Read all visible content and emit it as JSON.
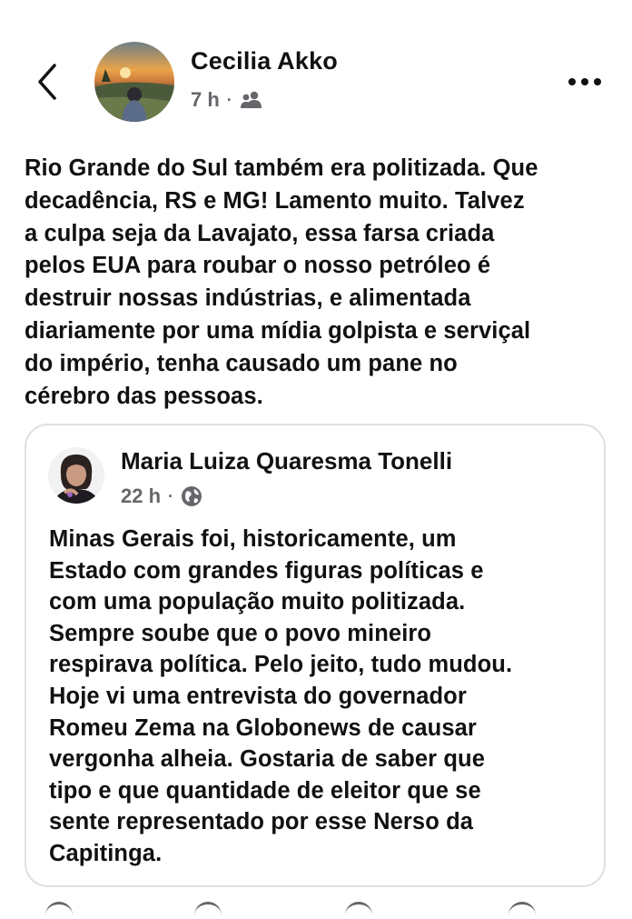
{
  "header": {
    "author": "Cecilia Akko",
    "time": "7 h",
    "separator": "·",
    "audience_icon": "friends-icon",
    "back_icon": "chevron-left-icon",
    "more_icon": "more-horizontal-icon"
  },
  "post": {
    "text": "Rio Grande do Sul também era politizada. Que\ndecadência, RS e MG! Lamento muito. Talvez\na culpa seja da Lavajato, essa farsa criada\npelos EUA para roubar o nosso petróleo é\ndestruir nossas indústrias, e alimentada\ndiariamente por uma mídia golpista e serviçal\ndo império, tenha causado um pane no\ncérebro das pessoas."
  },
  "shared": {
    "author": "Maria Luiza Quaresma Tonelli",
    "time": "22 h",
    "separator": "·",
    "audience_icon": "globe-icon",
    "text": "Minas Gerais foi, historicamente, um\nEstado com grandes figuras políticas e\ncom uma população muito politizada.\nSempre soube que o povo mineiro\nrespirava política. Pelo jeito, tudo mudou.\nHoje vi uma entrevista do governador\nRomeu Zema na Globonews de causar\nvergonha alheia. Gostaria de saber que\ntipo e que quantidade de eleitor que se\nsente representado por esse Nerso da\nCapitinga."
  },
  "colors": {
    "text": "#111111",
    "meta": "#65676b",
    "card_border": "#dedfe3",
    "background": "#ffffff"
  }
}
